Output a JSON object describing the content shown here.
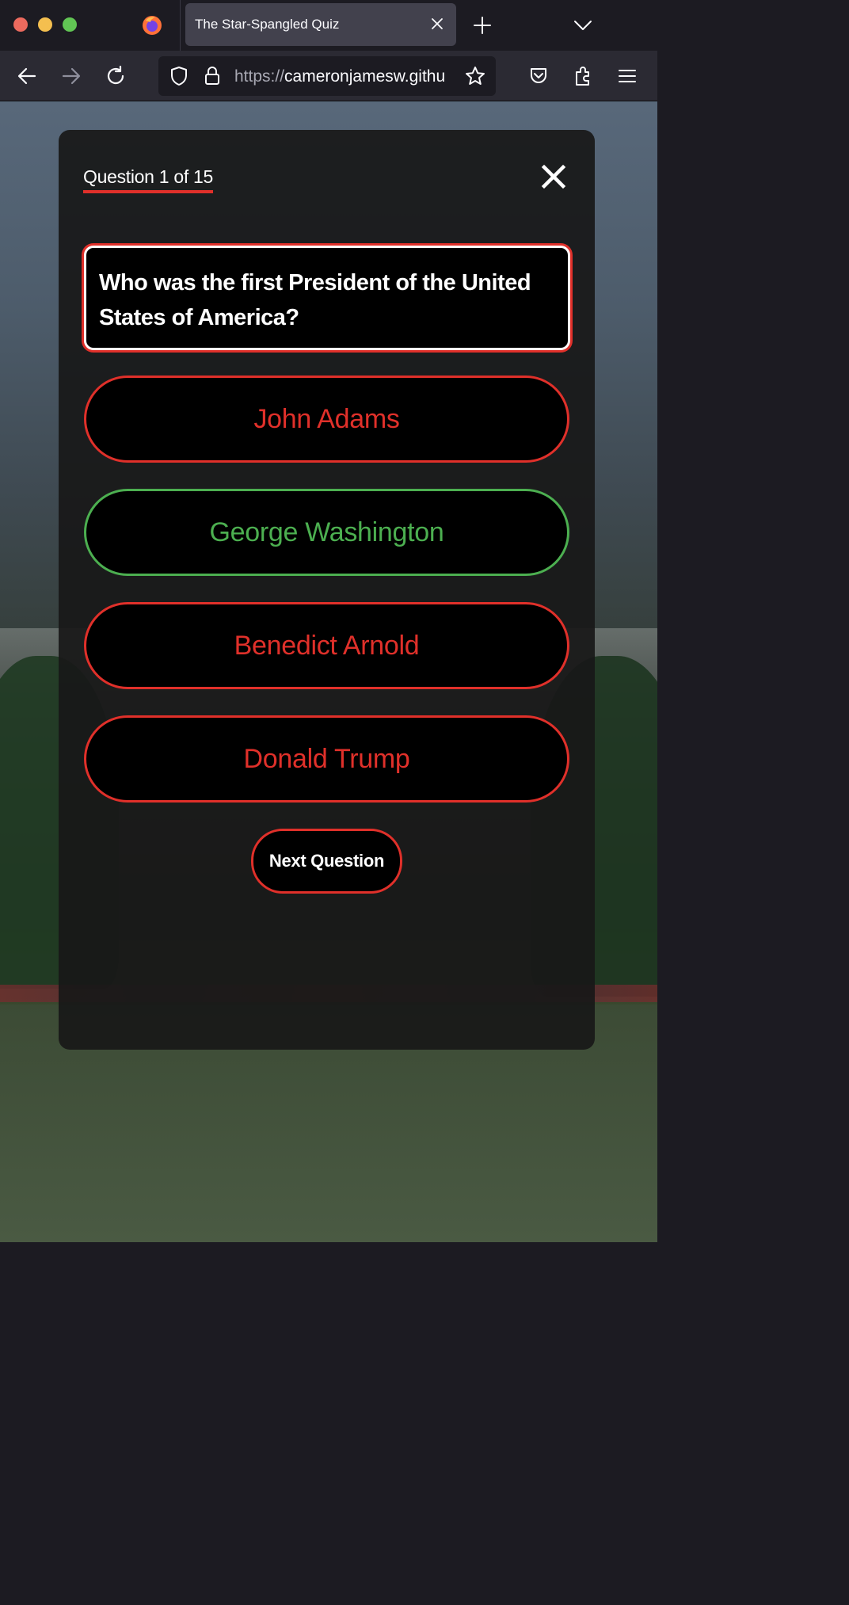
{
  "browser": {
    "tab_title": "The Star-Spangled Quiz",
    "url_protocol": "https://",
    "url_host": "cameronjamesw.githu"
  },
  "quiz": {
    "counter": "Question 1 of 15",
    "question": "Who was the first President of the United States of America?",
    "answers": [
      {
        "label": "John Adams",
        "state": "incorrect"
      },
      {
        "label": "George Washington",
        "state": "correct"
      },
      {
        "label": "Benedict Arnold",
        "state": "incorrect"
      },
      {
        "label": "Donald Trump",
        "state": "incorrect"
      }
    ],
    "next_label": "Next Question"
  },
  "colors": {
    "accent_red": "#e0302a",
    "correct_green": "#4caf50",
    "card_bg": "#181818"
  }
}
